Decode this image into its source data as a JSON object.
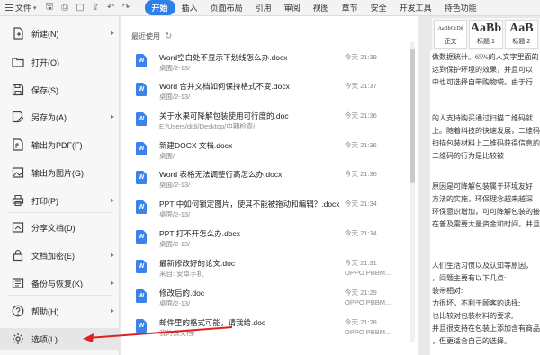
{
  "toolbar": {
    "file_label": "文件",
    "quick_icons": [
      "save-icon",
      "print-icon",
      "preview-icon",
      "export-icon",
      "undo-icon",
      "redo-icon"
    ],
    "tabs": [
      {
        "label": "开始",
        "active": true
      },
      {
        "label": "插入"
      },
      {
        "label": "页面布局"
      },
      {
        "label": "引用"
      },
      {
        "label": "审阅"
      },
      {
        "label": "视图"
      },
      {
        "label": "章节"
      },
      {
        "label": "安全"
      },
      {
        "label": "开发工具"
      },
      {
        "label": "特色功能"
      }
    ],
    "accent": "#2f7fea"
  },
  "styles": [
    {
      "sample": "AaBbCcDd",
      "caption": "正文"
    },
    {
      "sample": "AaBb",
      "caption": "标题 1"
    },
    {
      "sample": "AaB",
      "caption": "标题 2"
    }
  ],
  "menu": {
    "items": [
      {
        "label": "新建(N)",
        "icon": "new-doc-icon",
        "arrow": true
      },
      {
        "label": "打开(O)",
        "icon": "folder-open-icon",
        "arrow": false
      },
      {
        "label": "保存(S)",
        "icon": "save-icon",
        "arrow": false
      },
      {
        "label": "另存为(A)",
        "icon": "save-as-icon",
        "arrow": true
      },
      {
        "label": "输出为PDF(F)",
        "icon": "pdf-icon",
        "arrow": false
      },
      {
        "label": "输出为图片(G)",
        "icon": "image-icon",
        "arrow": false
      },
      {
        "label": "打印(P)",
        "icon": "print-icon",
        "arrow": true
      },
      {
        "label": "分享文档(D)",
        "icon": "share-icon",
        "arrow": false
      },
      {
        "label": "文档加密(E)",
        "icon": "lock-icon",
        "arrow": true
      },
      {
        "label": "备份与恢复(K)",
        "icon": "backup-icon",
        "arrow": true
      },
      {
        "label": "帮助(H)",
        "icon": "help-icon",
        "arrow": true
      },
      {
        "label": "选项(L)",
        "icon": "gear-icon",
        "arrow": false
      }
    ]
  },
  "recent": {
    "title": "最近使用",
    "files": [
      {
        "name": "Word空白处不显示下划线怎么办.docx",
        "path": "桌面/2-13/",
        "time": "今天 21:39",
        "source": ""
      },
      {
        "name": "Word 合并文档如何保持格式不变.docx",
        "path": "桌面/2-13/",
        "time": "今天 21:37",
        "source": ""
      },
      {
        "name": "关于水果可降解包装使用可行度的.doc",
        "path": "E:/Users/didi/Desktop/中期检查/",
        "time": "今天 21:36",
        "source": ""
      },
      {
        "name": "新建DOCX 文档.docx",
        "path": "桌面/",
        "time": "今天 21:36",
        "source": ""
      },
      {
        "name": "Word 表格无法调整行高怎么办.docx",
        "path": "桌面/2-13/",
        "time": "今天 21:36",
        "source": ""
      },
      {
        "name": "PPT 中如何锁定图片，使其不能被拖动和编辑？.docx",
        "path": "桌面/2-13/",
        "time": "今天 21:34",
        "source": ""
      },
      {
        "name": "PPT 打不开怎么办.docx",
        "path": "桌面/2-13/",
        "time": "今天 21:34",
        "source": ""
      },
      {
        "name": "最新修改好的论文.doc",
        "path": "来自: 安卓手机",
        "time": "今天 21:31",
        "source": "OPPO PBBM..."
      },
      {
        "name": "修改后的.doc",
        "path": "桌面/2-13/",
        "time": "今天 21:29",
        "source": "OPPO PBBM..."
      },
      {
        "name": "邮件里的格式可能，请我给.doc",
        "path": "我的云文档/",
        "time": "今天 21:28",
        "source": "OPPO PBBM..."
      }
    ]
  },
  "document": {
    "lines": [
      "做数据统计。65%的人文字里面的",
      "达到保护环境的效果，并且可以",
      "中也可选择自带购物袋。由于行",
      "",
      "的人支持购买通过扫描二维码就",
      "上。随着科技的快速发展，二维码",
      "扫描包装材料上二维码获得信息的",
      "二维码的行为是比较被",
      "",
      "原因是可降解包装属于环境友好",
      "方法的实施，环保理念越来越深",
      "环保意识增加，可可降解包装的接",
      "在普及需要大量资金和时间，并且",
      "",
      "人们生活习惯以及认知等原因，",
      "，问题主要有以下几点:",
      "装带相对:",
      "力很坏，不利于顾客的选择;",
      "也比较对包装材料的要求;",
      "并且很支持在包装上添加含有商品",
      "，但更适合自己的选择。"
    ]
  }
}
